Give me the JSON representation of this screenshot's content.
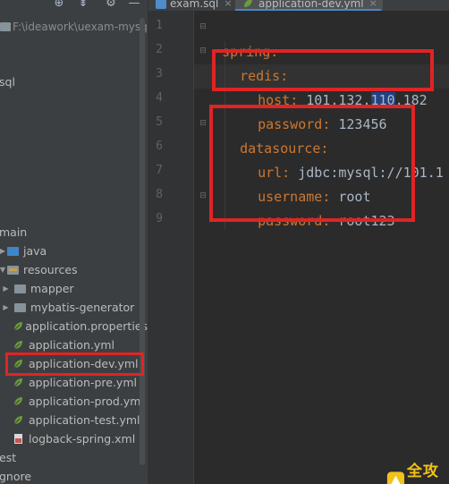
{
  "project_panel": {
    "root_path": "F:\\ideawork\\uexam-mysql",
    "truncated_labels": [
      "sql",
      "main",
      "est",
      "gnore"
    ],
    "tree": [
      {
        "label": "java",
        "kind": "folder-blue",
        "expanded": false
      },
      {
        "label": "resources",
        "kind": "folder-res",
        "expanded": true
      },
      {
        "label": "mapper",
        "kind": "folder-gray",
        "expanded": false
      },
      {
        "label": "mybatis-generator",
        "kind": "folder-gray",
        "expanded": false
      },
      {
        "label": "application.properties",
        "kind": "spring-file"
      },
      {
        "label": "application.yml",
        "kind": "spring-file"
      },
      {
        "label": "application-dev.yml",
        "kind": "spring-file",
        "selected": true
      },
      {
        "label": "application-pre.yml",
        "kind": "spring-file"
      },
      {
        "label": "application-prod.yml",
        "kind": "spring-file"
      },
      {
        "label": "application-test.yml",
        "kind": "spring-file"
      },
      {
        "label": "logback-spring.xml",
        "kind": "xml-file"
      }
    ]
  },
  "tabs": [
    {
      "label": "exam.sql",
      "icon": "sql-file-icon",
      "active": false
    },
    {
      "label": "application-dev.yml",
      "icon": "spring-leaf-icon",
      "active": true
    }
  ],
  "editor": {
    "line_numbers": [
      "1",
      "2",
      "3",
      "4",
      "5",
      "6",
      "7",
      "8",
      "9"
    ],
    "lines": {
      "l1_key": "spring",
      "l1_colon": ":",
      "l2_key": "redis",
      "l2_colon": ":",
      "l3_key": "host",
      "l3_colon": ":",
      "l3_val_a": " 101.132.",
      "l3_val_sel": "110",
      "l3_val_b": ".182",
      "l4_key": "password",
      "l4_colon": ":",
      "l4_val": " 123456",
      "l5_key": "datasource",
      "l5_colon": ":",
      "l6_key": "url",
      "l6_colon": ":",
      "l6_val": " jdbc:mysql://101.1",
      "l7_key": "username",
      "l7_colon": ":",
      "l7_val": " root",
      "l8_key": "password",
      "l8_colon": ":",
      "l8_val": " root123"
    }
  },
  "watermark": {
    "text": "全攻略"
  },
  "colors": {
    "editor_bg": "#2b2b2b",
    "panel_bg": "#3c3f41",
    "yaml_key": "#cc7832",
    "yaml_value": "#a9b7c6",
    "annotation_red": "#e02424",
    "selection": "#214283"
  }
}
